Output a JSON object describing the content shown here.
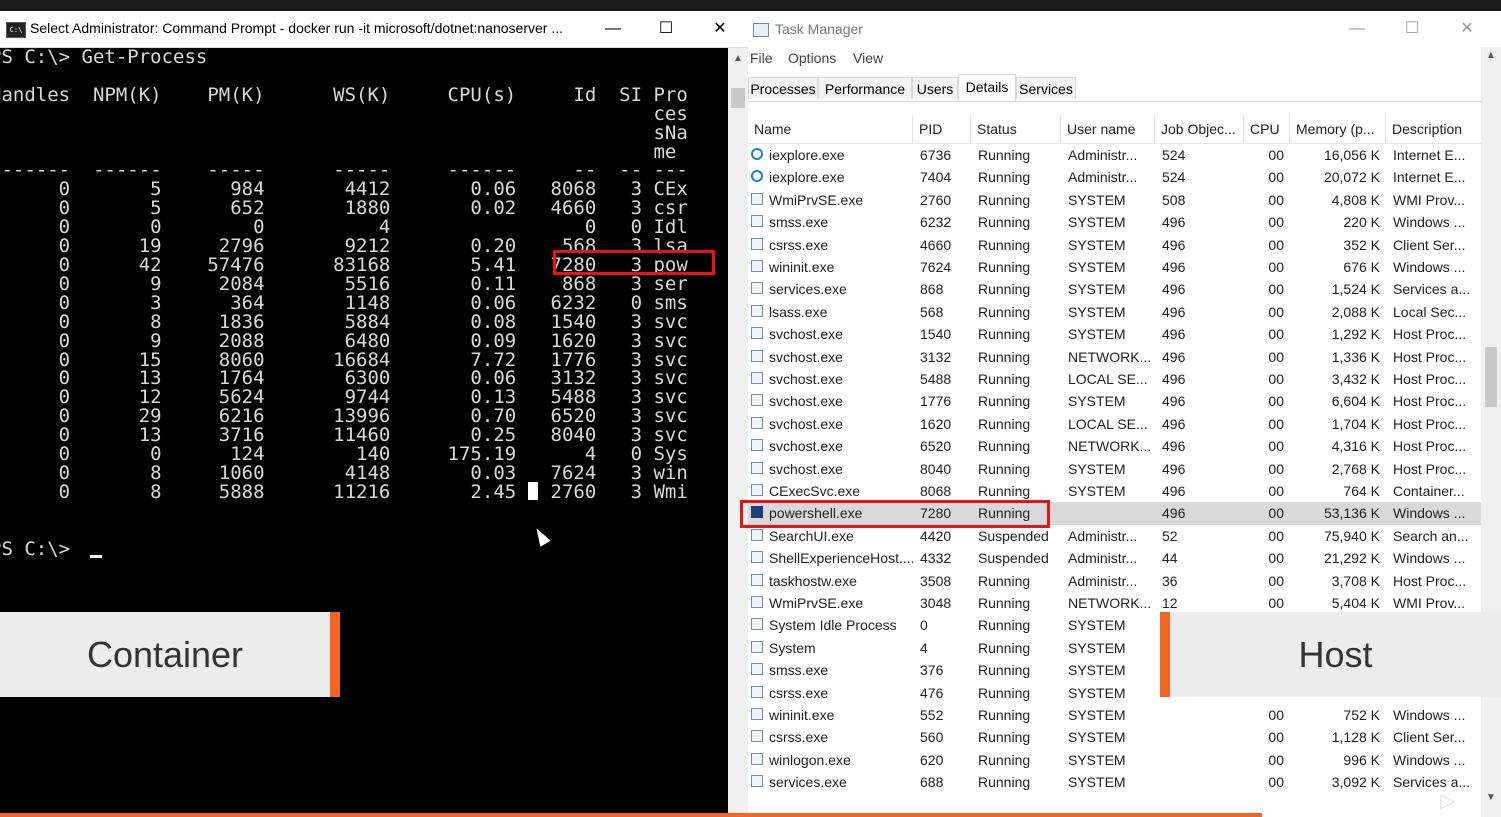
{
  "colors": {
    "highlight": "#ee1111",
    "accent_orange": "#f26522",
    "cmd_bg": "#000000",
    "cmd_text": "#d8d8d8",
    "selected_row": "#d9d9d9"
  },
  "cmd": {
    "title": "Select Administrator: Command Prompt - docker  run -it microsoft/dotnet:nanoserver ...",
    "icon": "cmd-prompt-icon",
    "controls": {
      "minimize": "—",
      "maximize": "☐",
      "close": "✕"
    },
    "output": "PS C:\\> Get-Process\n\nHandles  NPM(K)    PM(K)      WS(K)     CPU(s)     Id  SI Pro\n                                                          ces\n                                                          sNa\n                                                          me\n-------  ------    -----      -----     ------     --  -- ---\n      0       5      984       4412       0.06   8068   3 CEx\n      0       5      652       1880       0.02   4660   3 csr\n      0       0        0          4                 0   0 Idl\n      0      19     2796       9212       0.20    568   3 lsa\n      0      42    57476      83168       5.41   7280   3 pow\n      0       9     2084       5516       0.11    868   3 ser\n      0       3      364       1148       0.06   6232   0 sms\n      0       8     1836       5884       0.08   1540   3 svc\n      0       9     2088       6480       0.09   1620   3 svc\n      0      15     8060      16684       7.72   1776   3 svc\n      0      13     1764       6300       0.06   3132   3 svc\n      0      12     5624       9744       0.13   5488   3 svc\n      0      29     6216      13996       0.70   6520   3 svc\n      0      13     3716      11460       0.25   8040   3 svc\n      0       0      124        140     175.19      4   0 Sys\n      0       8     1060       4148       0.03   7624   3 win\n      0       8     5888      11216       2.45   2760   3 Wmi\n\n\nPS C:\\> ",
    "scroll_up": "▲"
  },
  "labels": {
    "container": "Container",
    "host": "Host"
  },
  "task_manager": {
    "title": "Task Manager",
    "controls": {
      "minimize": "—",
      "maximize": "☐",
      "close": "✕"
    },
    "menu": [
      "File",
      "Options",
      "View"
    ],
    "tabs": [
      "Processes",
      "Performance",
      "Users",
      "Details",
      "Services"
    ],
    "active_tab": "Details",
    "columns": [
      "Name",
      "PID",
      "Status",
      "User name",
      "Job Objec...",
      "CPU",
      "Memory (p...",
      "Description"
    ],
    "rows": [
      {
        "icon": "ie-icon",
        "name": "iexplore.exe",
        "pid": "6736",
        "status": "Running",
        "user": "Administr...",
        "job": "524",
        "cpu": "00",
        "mem": "16,056 K",
        "desc": "Internet E..."
      },
      {
        "icon": "ie-icon",
        "name": "iexplore.exe",
        "pid": "7404",
        "status": "Running",
        "user": "Administr...",
        "job": "524",
        "cpu": "00",
        "mem": "20,072 K",
        "desc": "Internet E..."
      },
      {
        "icon": "wmi-icon",
        "name": "WmiPrvSE.exe",
        "pid": "2760",
        "status": "Running",
        "user": "SYSTEM",
        "job": "508",
        "cpu": "00",
        "mem": "4,808 K",
        "desc": "WMI Prov..."
      },
      {
        "icon": "app-icon",
        "name": "smss.exe",
        "pid": "6232",
        "status": "Running",
        "user": "SYSTEM",
        "job": "496",
        "cpu": "00",
        "mem": "220 K",
        "desc": "Windows ..."
      },
      {
        "icon": "app-icon",
        "name": "csrss.exe",
        "pid": "4660",
        "status": "Running",
        "user": "SYSTEM",
        "job": "496",
        "cpu": "00",
        "mem": "352 K",
        "desc": "Client Ser..."
      },
      {
        "icon": "app-icon",
        "name": "wininit.exe",
        "pid": "7624",
        "status": "Running",
        "user": "SYSTEM",
        "job": "496",
        "cpu": "00",
        "mem": "676 K",
        "desc": "Windows ..."
      },
      {
        "icon": "app-icon",
        "name": "services.exe",
        "pid": "868",
        "status": "Running",
        "user": "SYSTEM",
        "job": "496",
        "cpu": "00",
        "mem": "1,524 K",
        "desc": "Services a..."
      },
      {
        "icon": "app-icon",
        "name": "lsass.exe",
        "pid": "568",
        "status": "Running",
        "user": "SYSTEM",
        "job": "496",
        "cpu": "00",
        "mem": "2,088 K",
        "desc": "Local Sec..."
      },
      {
        "icon": "app-icon",
        "name": "svchost.exe",
        "pid": "1540",
        "status": "Running",
        "user": "SYSTEM",
        "job": "496",
        "cpu": "00",
        "mem": "1,292 K",
        "desc": "Host Proc..."
      },
      {
        "icon": "app-icon",
        "name": "svchost.exe",
        "pid": "3132",
        "status": "Running",
        "user": "NETWORK...",
        "job": "496",
        "cpu": "00",
        "mem": "1,336 K",
        "desc": "Host Proc..."
      },
      {
        "icon": "app-icon",
        "name": "svchost.exe",
        "pid": "5488",
        "status": "Running",
        "user": "LOCAL SE...",
        "job": "496",
        "cpu": "00",
        "mem": "3,432 K",
        "desc": "Host Proc..."
      },
      {
        "icon": "app-icon",
        "name": "svchost.exe",
        "pid": "1776",
        "status": "Running",
        "user": "SYSTEM",
        "job": "496",
        "cpu": "00",
        "mem": "6,604 K",
        "desc": "Host Proc..."
      },
      {
        "icon": "app-icon",
        "name": "svchost.exe",
        "pid": "1620",
        "status": "Running",
        "user": "LOCAL SE...",
        "job": "496",
        "cpu": "00",
        "mem": "1,704 K",
        "desc": "Host Proc..."
      },
      {
        "icon": "app-icon",
        "name": "svchost.exe",
        "pid": "6520",
        "status": "Running",
        "user": "NETWORK...",
        "job": "496",
        "cpu": "00",
        "mem": "4,316 K",
        "desc": "Host Proc..."
      },
      {
        "icon": "app-icon",
        "name": "svchost.exe",
        "pid": "8040",
        "status": "Running",
        "user": "SYSTEM",
        "job": "496",
        "cpu": "00",
        "mem": "2,768 K",
        "desc": "Host Proc..."
      },
      {
        "icon": "app-icon",
        "name": "CExecSvc.exe",
        "pid": "8068",
        "status": "Running",
        "user": "SYSTEM",
        "job": "496",
        "cpu": "00",
        "mem": "764 K",
        "desc": "Container..."
      },
      {
        "icon": "powershell-icon",
        "name": "powershell.exe",
        "pid": "7280",
        "status": "Running",
        "user": "",
        "job": "496",
        "cpu": "00",
        "mem": "53,136 K",
        "desc": "Windows ...",
        "selected": true
      },
      {
        "icon": "app-icon",
        "name": "SearchUI.exe",
        "pid": "4420",
        "status": "Suspended",
        "user": "Administr...",
        "job": "52",
        "cpu": "00",
        "mem": "75,940 K",
        "desc": "Search an..."
      },
      {
        "icon": "app-icon",
        "name": "ShellExperienceHost....",
        "pid": "4332",
        "status": "Suspended",
        "user": "Administr...",
        "job": "44",
        "cpu": "00",
        "mem": "21,292 K",
        "desc": "Windows ..."
      },
      {
        "icon": "app-icon",
        "name": "taskhostw.exe",
        "pid": "3508",
        "status": "Running",
        "user": "Administr...",
        "job": "36",
        "cpu": "00",
        "mem": "3,708 K",
        "desc": "Host Proc..."
      },
      {
        "icon": "wmi-icon",
        "name": "WmiPrvSE.exe",
        "pid": "3048",
        "status": "Running",
        "user": "NETWORK...",
        "job": "12",
        "cpu": "00",
        "mem": "5,404 K",
        "desc": "WMI Prov..."
      },
      {
        "icon": "app-icon",
        "name": "System Idle Process",
        "pid": "0",
        "status": "Running",
        "user": "SYSTEM",
        "job": "",
        "cpu": "",
        "mem": "",
        "desc": ""
      },
      {
        "icon": "app-icon",
        "name": "System",
        "pid": "4",
        "status": "Running",
        "user": "SYSTEM",
        "job": "",
        "cpu": "",
        "mem": "",
        "desc": ""
      },
      {
        "icon": "app-icon",
        "name": "smss.exe",
        "pid": "376",
        "status": "Running",
        "user": "SYSTEM",
        "job": "",
        "cpu": "",
        "mem": "",
        "desc": ""
      },
      {
        "icon": "app-icon",
        "name": "csrss.exe",
        "pid": "476",
        "status": "Running",
        "user": "SYSTEM",
        "job": "",
        "cpu": "",
        "mem": "",
        "desc": ""
      },
      {
        "icon": "app-icon",
        "name": "wininit.exe",
        "pid": "552",
        "status": "Running",
        "user": "SYSTEM",
        "job": "",
        "cpu": "00",
        "mem": "752 K",
        "desc": "Windows ..."
      },
      {
        "icon": "app-icon",
        "name": "csrss.exe",
        "pid": "560",
        "status": "Running",
        "user": "SYSTEM",
        "job": "",
        "cpu": "00",
        "mem": "1,128 K",
        "desc": "Client Ser..."
      },
      {
        "icon": "app-icon",
        "name": "winlogon.exe",
        "pid": "620",
        "status": "Running",
        "user": "SYSTEM",
        "job": "",
        "cpu": "00",
        "mem": "996 K",
        "desc": "Windows ..."
      },
      {
        "icon": "app-icon",
        "name": "services.exe",
        "pid": "688",
        "status": "Running",
        "user": "SYSTEM",
        "job": "",
        "cpu": "00",
        "mem": "3,092 K",
        "desc": "Services a..."
      }
    ],
    "scroll_up": "▲",
    "scroll_down": "▼"
  }
}
